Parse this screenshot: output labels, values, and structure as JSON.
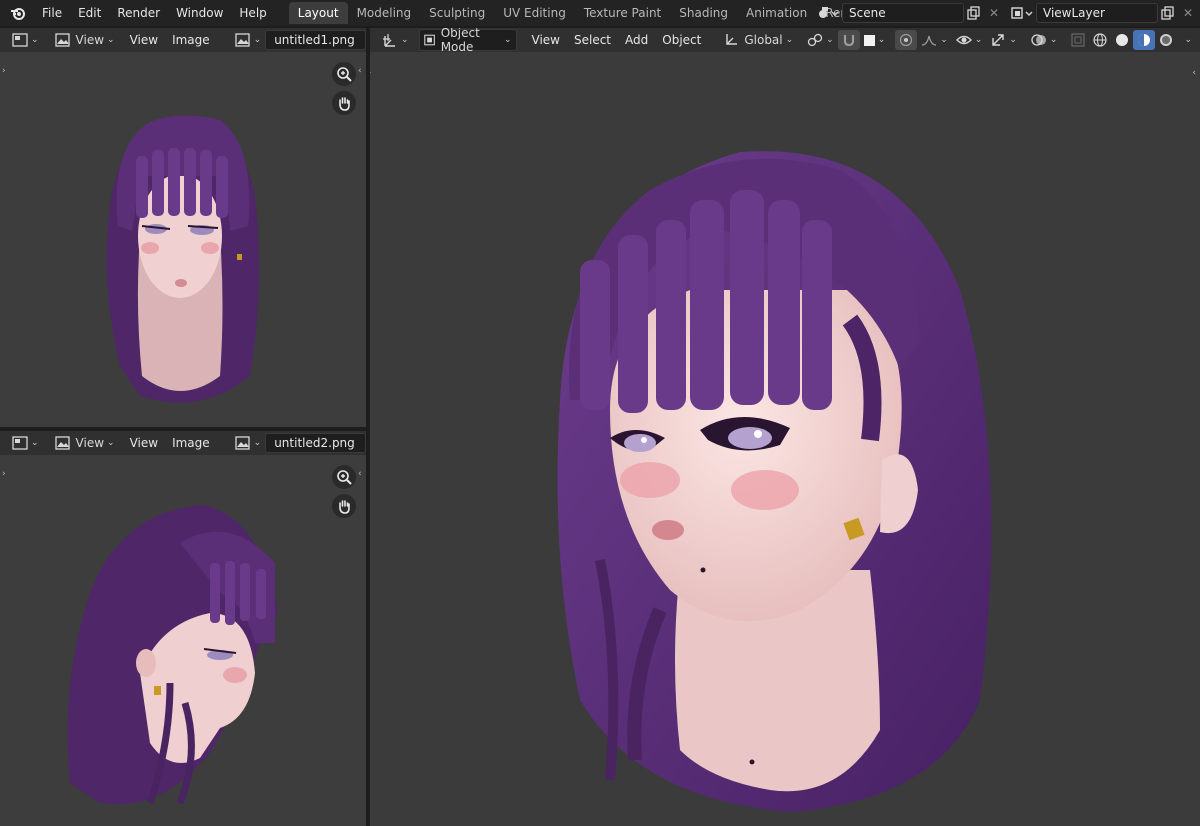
{
  "menu": [
    "File",
    "Edit",
    "Render",
    "Window",
    "Help"
  ],
  "workspaces": [
    "Layout",
    "Modeling",
    "Sculpting",
    "UV Editing",
    "Texture Paint",
    "Shading",
    "Animation",
    "Rendering",
    "("
  ],
  "active_workspace": "Layout",
  "scene": {
    "label": "Scene"
  },
  "view_layer": {
    "label": "ViewLayer"
  },
  "image_editor_top": {
    "view_dropdown": "View",
    "view_menu": "View",
    "image_menu": "Image",
    "image_name": "untitled1.png"
  },
  "image_editor_bottom": {
    "view_dropdown": "View",
    "view_menu": "View",
    "image_menu": "Image",
    "image_name": "untitled2.png"
  },
  "viewport": {
    "mode": "Object Mode",
    "menus": [
      "View",
      "Select",
      "Add",
      "Object"
    ],
    "orientation": "Global"
  },
  "colors": {
    "hair": "#5b2f78",
    "skin": "#f1d2d2",
    "accent": "#4772b3",
    "earring": "#c99a23"
  }
}
